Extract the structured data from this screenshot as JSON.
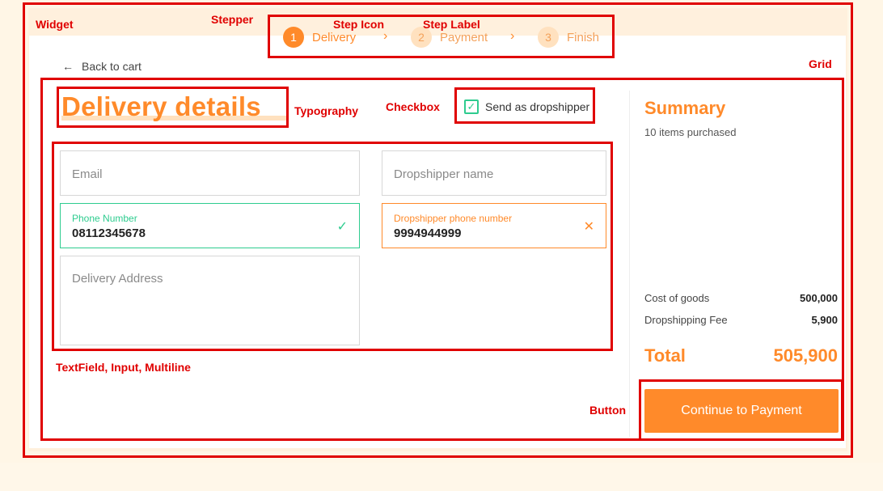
{
  "annotations": {
    "widget": "Widget",
    "stepper": "Stepper",
    "step_icon": "Step Icon",
    "step_label": "Step Label",
    "grid": "Grid",
    "typography": "Typography",
    "checkbox": "Checkbox",
    "textfield": "TextField, Input, Multiline",
    "button": "Button"
  },
  "stepper": {
    "steps": [
      {
        "number": "1",
        "label": "Delivery",
        "state": "active"
      },
      {
        "number": "2",
        "label": "Payment",
        "state": "inactive"
      },
      {
        "number": "3",
        "label": "Finish",
        "state": "inactive"
      }
    ],
    "separator": "›"
  },
  "nav": {
    "back_arrow": "←",
    "back_label": "Back to cart"
  },
  "form": {
    "title": "Delivery details",
    "dropshipper_checkbox": {
      "label": "Send as dropshipper",
      "checked": true,
      "check_glyph": "✓"
    },
    "email": {
      "placeholder": "Email"
    },
    "dropshipper_name": {
      "placeholder": "Dropshipper name"
    },
    "phone": {
      "label": "Phone Number",
      "value": "08112345678",
      "status": "valid",
      "status_glyph": "✓"
    },
    "dropshipper_phone": {
      "label": "Dropshipper phone number",
      "value": "9994944999",
      "status": "invalid",
      "status_glyph": "✕"
    },
    "address": {
      "placeholder": "Delivery Address"
    }
  },
  "summary": {
    "title": "Summary",
    "items_purchased": "10 items purchased",
    "rows": [
      {
        "label": "Cost of goods",
        "value": "500,000"
      },
      {
        "label": "Dropshipping Fee",
        "value": "5,900"
      }
    ],
    "total_label": "Total",
    "total_value": "505,900",
    "cta": "Continue to Payment"
  },
  "colors": {
    "accent": "#ff8a2a",
    "success": "#2ecc8f",
    "annotation": "#e00000",
    "background": "#fff6e6"
  }
}
